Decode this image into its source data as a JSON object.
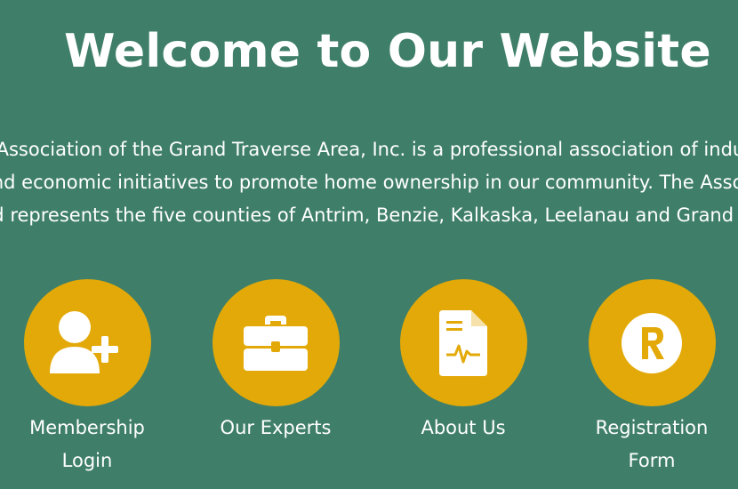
{
  "header": {
    "title": "Welcome to Our Website"
  },
  "intro": {
    "lines": [
      "s Association of the Grand Traverse Area, Inc. is a professional association of industr",
      "and economic initiatives to promote home ownership in our community. The Assoc",
      "nd represents the five counties of Antrim, Benzie, Kalkaska, Leelanau and Grand Tra"
    ]
  },
  "tiles": [
    {
      "label": "Membership\nLogin",
      "icon": "add-user-icon"
    },
    {
      "label": "Our Experts",
      "icon": "briefcase-icon"
    },
    {
      "label": "About Us",
      "icon": "document-chart-icon"
    },
    {
      "label": "Registration\nForm",
      "icon": "registered-r-icon"
    }
  ],
  "colors": {
    "background": "#3f7f69",
    "accent": "#e3a908",
    "text": "#ffffff"
  }
}
